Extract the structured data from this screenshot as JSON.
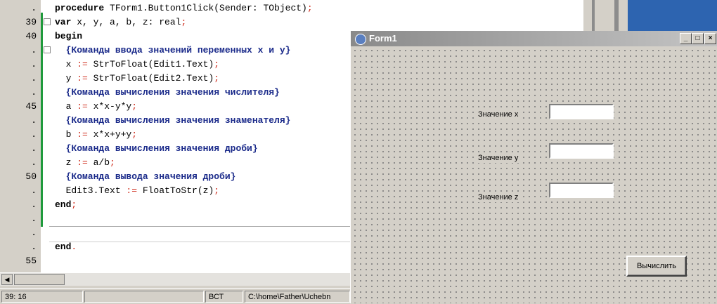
{
  "editor": {
    "gutter": [
      {
        "label": "."
      },
      {
        "label": "39"
      },
      {
        "label": "40"
      },
      {
        "label": "."
      },
      {
        "label": "."
      },
      {
        "label": "."
      },
      {
        "label": "."
      },
      {
        "label": "45"
      },
      {
        "label": "."
      },
      {
        "label": "."
      },
      {
        "label": "."
      },
      {
        "label": "."
      },
      {
        "label": "50"
      },
      {
        "label": "."
      },
      {
        "label": "."
      },
      {
        "label": "."
      },
      {
        "label": "."
      },
      {
        "label": "."
      },
      {
        "label": "55"
      }
    ],
    "lines": [
      {
        "tokens": [
          {
            "t": "kw",
            "v": "procedure "
          },
          {
            "t": "id",
            "v": "TForm1.Button1Click(Sender: TObject)"
          },
          {
            "t": "op",
            "v": ";"
          }
        ]
      },
      {
        "tokens": [
          {
            "t": "kw",
            "v": "var "
          },
          {
            "t": "id",
            "v": "x, y, a, b, z: real"
          },
          {
            "t": "op",
            "v": ";"
          }
        ]
      },
      {
        "tokens": [
          {
            "t": "kw",
            "v": "begin"
          }
        ]
      },
      {
        "tokens": [
          {
            "t": "cm",
            "v": "  {Команды ввода значений переменных x и y}"
          }
        ]
      },
      {
        "tokens": [
          {
            "t": "id",
            "v": "  x "
          },
          {
            "t": "op",
            "v": ":= "
          },
          {
            "t": "id",
            "v": "StrToFloat(Edit1.Text)"
          },
          {
            "t": "op",
            "v": ";"
          }
        ]
      },
      {
        "tokens": [
          {
            "t": "id",
            "v": "  y "
          },
          {
            "t": "op",
            "v": ":= "
          },
          {
            "t": "id",
            "v": "StrToFloat(Edit2.Text)"
          },
          {
            "t": "op",
            "v": ";"
          }
        ]
      },
      {
        "tokens": [
          {
            "t": "cm",
            "v": "  {Команда вычисления значения числителя}"
          }
        ]
      },
      {
        "tokens": [
          {
            "t": "id",
            "v": "  a "
          },
          {
            "t": "op",
            "v": ":= "
          },
          {
            "t": "id",
            "v": "x*x-y*y"
          },
          {
            "t": "op",
            "v": ";"
          }
        ]
      },
      {
        "tokens": [
          {
            "t": "cm",
            "v": "  {Команда вычисления значения знаменателя}"
          }
        ]
      },
      {
        "tokens": [
          {
            "t": "id",
            "v": "  b "
          },
          {
            "t": "op",
            "v": ":= "
          },
          {
            "t": "id",
            "v": "x*x+y+y"
          },
          {
            "t": "op",
            "v": ";"
          }
        ]
      },
      {
        "tokens": [
          {
            "t": "cm",
            "v": "  {Команда вычисления значения дроби}"
          }
        ]
      },
      {
        "tokens": [
          {
            "t": "id",
            "v": "  z "
          },
          {
            "t": "op",
            "v": ":= "
          },
          {
            "t": "id",
            "v": "a/b"
          },
          {
            "t": "op",
            "v": ";"
          }
        ]
      },
      {
        "tokens": [
          {
            "t": "cm",
            "v": "  {Команда вывода значения дроби}"
          }
        ]
      },
      {
        "tokens": [
          {
            "t": "id",
            "v": "  Edit3.Text "
          },
          {
            "t": "op",
            "v": ":= "
          },
          {
            "t": "id",
            "v": "FloatToStr(z)"
          },
          {
            "t": "op",
            "v": ";"
          }
        ]
      },
      {
        "tokens": [
          {
            "t": "kw",
            "v": "end"
          },
          {
            "t": "op",
            "v": ";"
          }
        ]
      },
      {
        "tokens": []
      },
      {
        "tokens": []
      },
      {
        "tokens": [
          {
            "t": "kw",
            "v": "end"
          },
          {
            "t": "op",
            "v": "."
          }
        ]
      }
    ]
  },
  "statusbar": {
    "position": "39: 16",
    "mode": "ВСТ",
    "path": "C:\\home\\Father\\Uchebn"
  },
  "form": {
    "title": "Form1",
    "minimize": "_",
    "maximize": "□",
    "close": "×",
    "label_x": "Значение x",
    "label_y": "Значение y",
    "label_z": "Значение z",
    "edit1_value": "",
    "edit2_value": "",
    "edit3_value": "",
    "button_label": "Вычислить"
  }
}
